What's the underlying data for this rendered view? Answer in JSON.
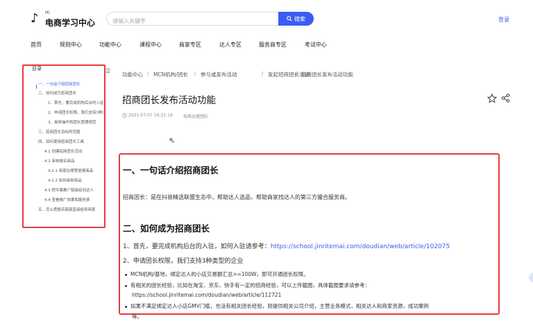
{
  "header": {
    "logo_small": "Hi",
    "logo_text": "电商学习中心",
    "search_placeholder": "请输入关键字",
    "search_button": "搜索",
    "login": "登录"
  },
  "nav": [
    "首页",
    "规则中心",
    "功能中心",
    "课程中心",
    "商家专区",
    "达人专区",
    "服务商专区",
    "考试中心"
  ],
  "toc": {
    "title": "目录",
    "toggle": "☰",
    "items": [
      "一、一句话介绍招商团长",
      "二、如何成为招商团长",
      "1、首先，要完成机构后台的入驻",
      "2、申请团长权限，我们支持3种类型",
      "3、具体操作和团长管理规范",
      "三、招商团长目标的范围",
      "四、如何使用招商团长工具",
      "4.1 创建招商团长活动",
      "4.2 审核报名商品",
      "4.2.1 商家在哪里提报商品",
      "4.2.2 如何审核商品",
      "4.3 把专属推广链接给到达人",
      "4.4 查看推广效果和服务费",
      "五、怎么把报名链接直接给到商家"
    ]
  },
  "breadcrumb": [
    "功能中心",
    "MCN机构/团长",
    "参与或发布活动",
    "发起招商团长活动",
    "招商团长发布活动功能"
  ],
  "article": {
    "title": "招商团长发布活动功能",
    "date": "2021-07-07 16:31:19",
    "author": "电商运营团队",
    "h2_1": "一、一句话介绍招商团长",
    "p1": "招商团长：是在抖音精选联盟生态中，帮助达人选品，帮助商家找达人的第三方撮合服务商。",
    "h2_2": "二、如何成为招商团长",
    "step1_text": "1、首先，要完成机构后台的入驻，如何入驻请参考：",
    "step1_link": "https://school.jinritemai.com/doudian/web/article/102075",
    "step2_text": "2、申请团长权限，我们支持3种类型的企业",
    "bullet1": "MCN机构/基地，绑定达人的小店交易额汇总>=100W，即可开通团长权限。",
    "bullet2": "有相关的团长经验，比如在淘宝、京东、快手有一定的招商经验，可以上传截图，具体截图要求请参考：",
    "bullet2_link": "https://school.jinritemai.com/doudian/web/article/112721",
    "bullet3": "如果不满足绑定达人小店GMV门槛，也没有相关团长经验，则提供相关公司介绍，主营业务模式，相关达人和商家资源，成功案例",
    "bullet3_cont": "等。"
  },
  "colors": {
    "accent": "#3c5bf5",
    "highlight_border": "#e83a3a"
  }
}
